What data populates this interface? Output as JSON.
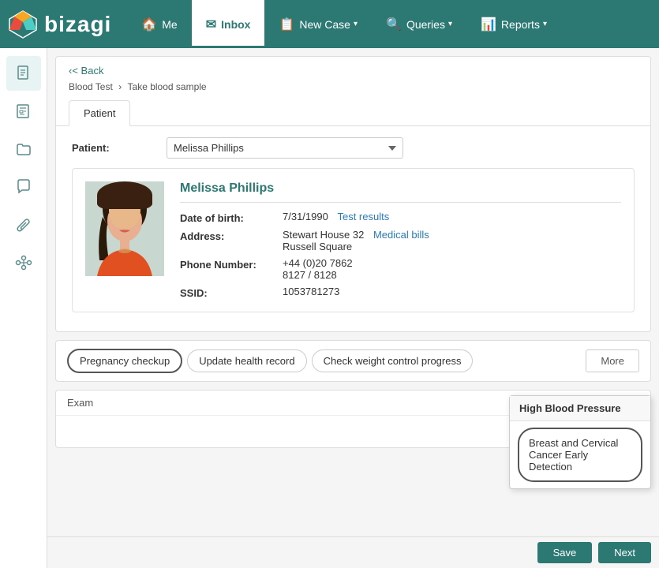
{
  "brand": {
    "name": "bizagi"
  },
  "nav": {
    "items": [
      {
        "id": "me",
        "label": "Me",
        "icon": "🏠",
        "active": false,
        "has_dropdown": false
      },
      {
        "id": "inbox",
        "label": "Inbox",
        "icon": "✉",
        "active": true,
        "has_dropdown": false
      },
      {
        "id": "new_case",
        "label": "New Case",
        "icon": "📋",
        "active": false,
        "has_dropdown": true
      },
      {
        "id": "queries",
        "label": "Queries",
        "icon": "🔍",
        "active": false,
        "has_dropdown": true
      },
      {
        "id": "reports",
        "label": "Reports",
        "icon": "📊",
        "active": false,
        "has_dropdown": true
      }
    ]
  },
  "sidebar": {
    "items": [
      {
        "id": "doc1",
        "icon": "📄",
        "label": "document"
      },
      {
        "id": "doc2",
        "icon": "📋",
        "label": "form"
      },
      {
        "id": "folder",
        "icon": "📁",
        "label": "folder"
      },
      {
        "id": "chat",
        "icon": "💬",
        "label": "chat"
      },
      {
        "id": "attach",
        "icon": "📎",
        "label": "attachment"
      },
      {
        "id": "process",
        "icon": "⚙",
        "label": "process"
      }
    ]
  },
  "back_link": "< Back",
  "breadcrumb": {
    "root": "Blood Test",
    "separator": "›",
    "current": "Take blood sample"
  },
  "tabs": [
    {
      "id": "patient",
      "label": "Patient",
      "active": true
    }
  ],
  "patient_field": {
    "label": "Patient:",
    "value": "Melissa Phillips"
  },
  "patient_card": {
    "name": "Melissa Phillips",
    "dob_label": "Date of birth:",
    "dob_value": "7/31/1990",
    "test_results_link": "Test results",
    "address_label": "Address:",
    "address_line1": "Stewart House 32",
    "medical_bills_link": "Medical bills",
    "address_line2": "Russell Square",
    "phone_label": "Phone Number:",
    "phone_value": "+44 (0)20 7862",
    "phone_value2": "8127 / 8128",
    "ssid_label": "SSID:",
    "ssid_value": "1053781273"
  },
  "action_buttons": [
    {
      "id": "pregnancy",
      "label": "Pregnancy checkup",
      "outlined": true
    },
    {
      "id": "health",
      "label": "Update health record",
      "outlined": false
    },
    {
      "id": "weight",
      "label": "Check weight control progress",
      "outlined": false
    }
  ],
  "more_button": "More",
  "exam_section": {
    "header": "Exam"
  },
  "dropdown_popup": {
    "header": "High Blood Pressure",
    "item": "Breast and Cervical Cancer Early Detection"
  },
  "bottom_buttons": {
    "save": "Save",
    "next": "Next"
  }
}
